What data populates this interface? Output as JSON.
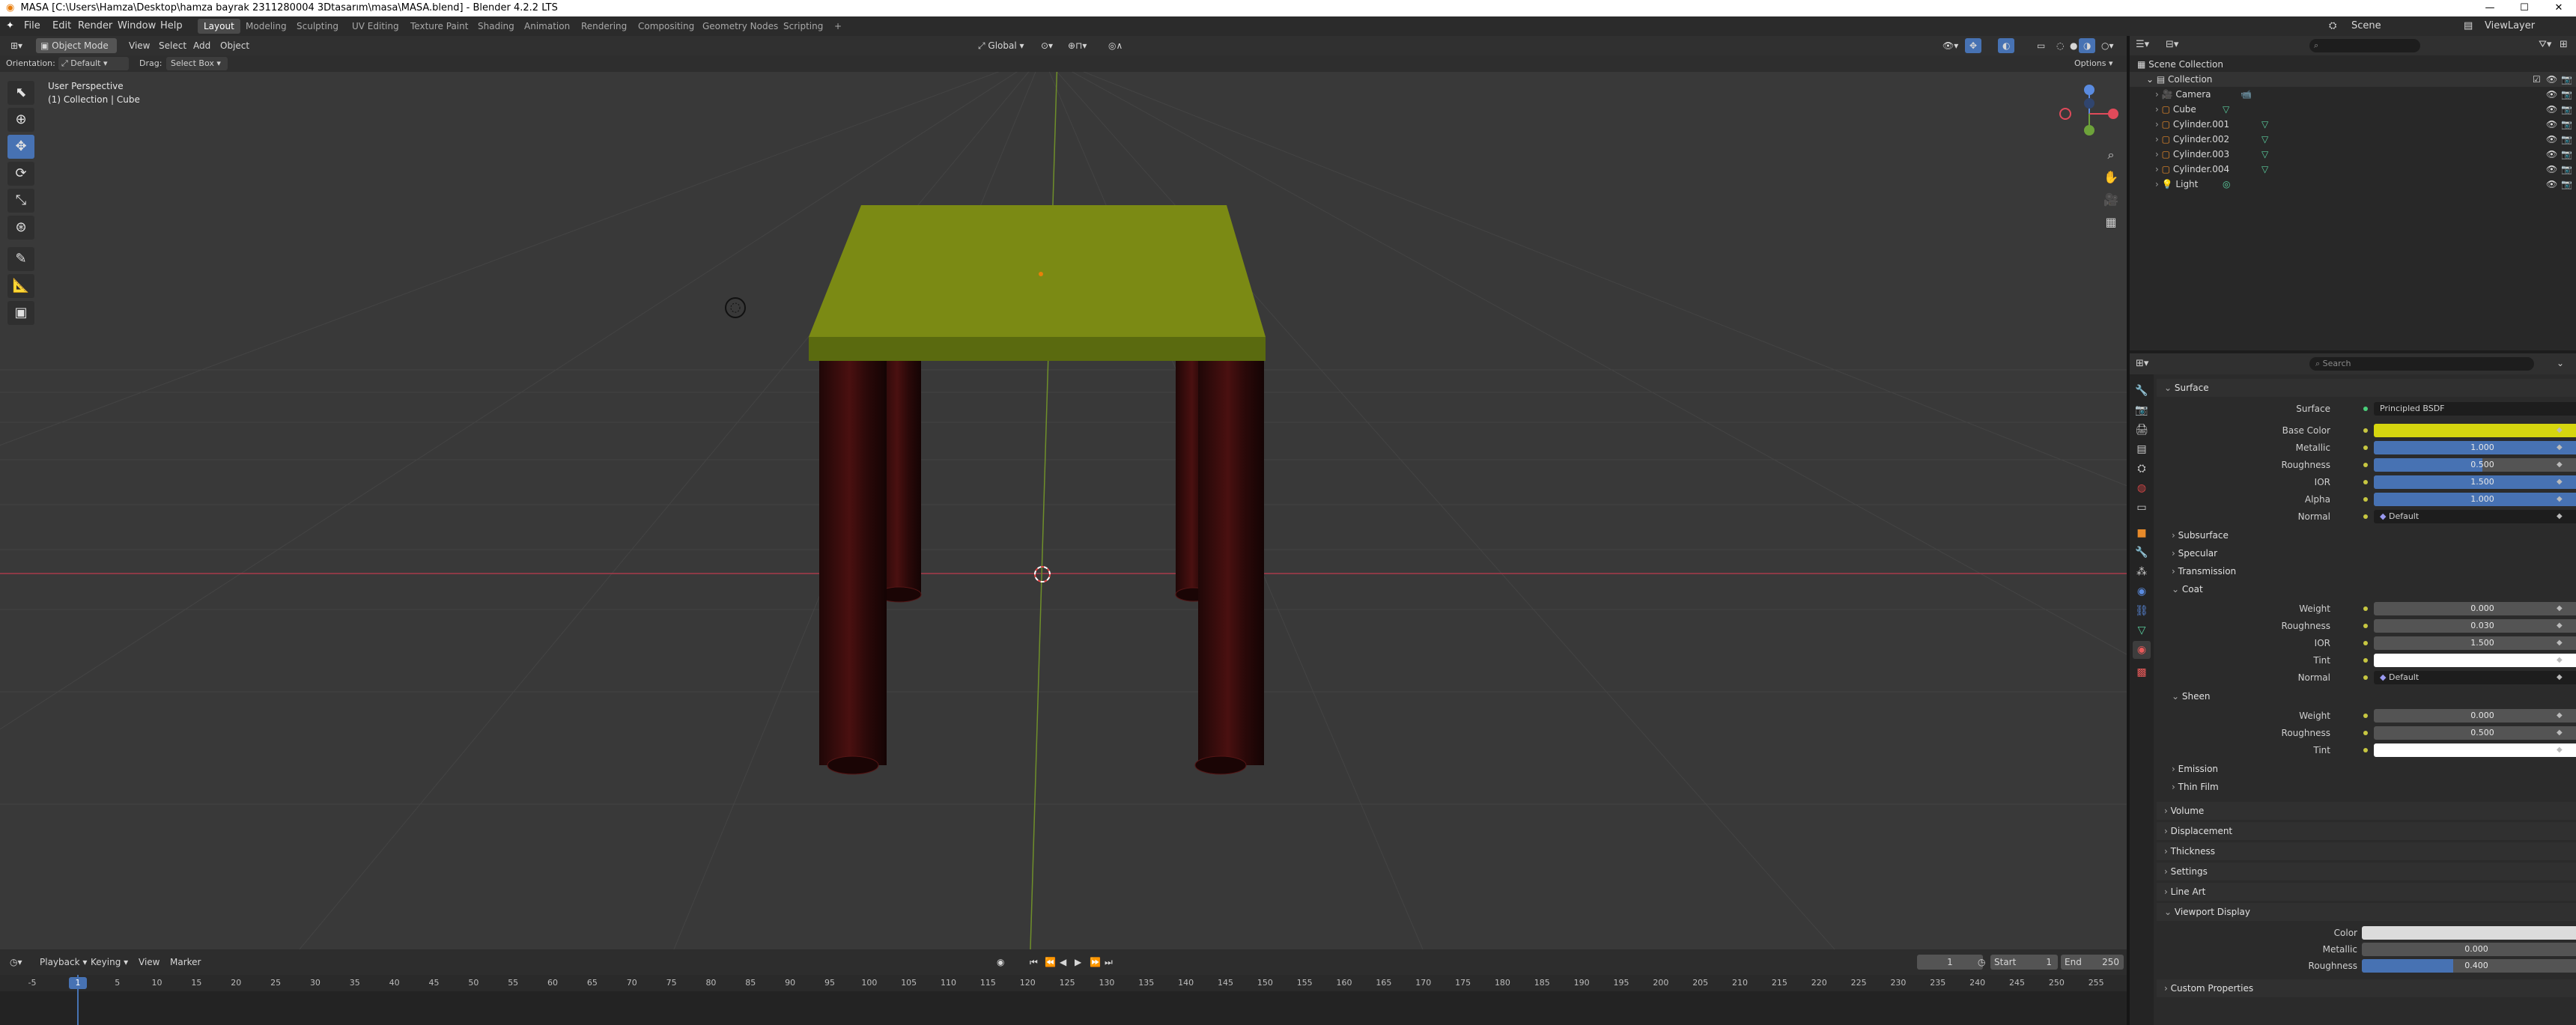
{
  "window": {
    "title": "MASA [C:\\Users\\Hamza\\Desktop\\hamza bayrak 2311280004   3Dtasarım\\masa\\MASA.blend] - Blender 4.2.2 LTS"
  },
  "menu": [
    "File",
    "Edit",
    "Render",
    "Window",
    "Help"
  ],
  "workspaces": [
    "Layout",
    "Modeling",
    "Sculpting",
    "UV Editing",
    "Texture Paint",
    "Shading",
    "Animation",
    "Rendering",
    "Compositing",
    "Geometry Nodes",
    "Scripting"
  ],
  "active_workspace": "Layout",
  "scene": {
    "name": "Scene",
    "view_layer": "ViewLayer"
  },
  "viewport_header": {
    "mode": "Object Mode",
    "view": "View",
    "select": "Select",
    "add": "Add",
    "object": "Object",
    "orientation_transform": "Global",
    "options": "Options"
  },
  "tool_header": {
    "orientation_label": "Orientation:",
    "orientation": "Default",
    "drag_label": "Drag:",
    "drag": "Select Box"
  },
  "viewport_overlay": {
    "perspective": "User Perspective",
    "context": "(1) Collection | Cube"
  },
  "timeline": {
    "playback": "Playback",
    "keying": "Keying",
    "view": "View",
    "marker": "Marker",
    "current_frame": "1",
    "start_label": "Start",
    "start": "1",
    "end_label": "End",
    "end": "250",
    "ticks": [
      "-5",
      "0",
      "5",
      "10",
      "15",
      "20",
      "25",
      "30",
      "35",
      "40",
      "45",
      "50",
      "55",
      "60",
      "65",
      "70",
      "75",
      "80",
      "85",
      "90",
      "95",
      "100",
      "105",
      "110",
      "115",
      "120",
      "125",
      "130",
      "135",
      "140",
      "145",
      "150",
      "155",
      "160",
      "165",
      "170",
      "175",
      "180",
      "185",
      "190",
      "195",
      "200",
      "205",
      "210",
      "215",
      "220",
      "225",
      "230",
      "235",
      "240",
      "245",
      "250",
      "255"
    ]
  },
  "outliner": {
    "search_placeholder": "",
    "root": "Scene Collection",
    "collection": "Collection",
    "items": [
      "Camera",
      "Cube",
      "Cylinder.001",
      "Cylinder.002",
      "Cylinder.003",
      "Cylinder.004",
      "Light"
    ]
  },
  "properties": {
    "search_placeholder": "Search",
    "surface_section": "Surface",
    "surface_label": "Surface",
    "surface_value": "Principled BSDF",
    "rows": [
      {
        "label": "Base Color",
        "type": "color",
        "color": "#d6d60f"
      },
      {
        "label": "Metallic",
        "value": "1.000",
        "fill": 1.0
      },
      {
        "label": "Roughness",
        "value": "0.500",
        "fill": 0.5
      },
      {
        "label": "IOR",
        "value": "1.500",
        "fill": 1.0
      },
      {
        "label": "Alpha",
        "value": "1.000",
        "fill": 1.0
      },
      {
        "label": "Normal",
        "value": "Default",
        "type": "text"
      }
    ],
    "collapsed": [
      "Subsurface",
      "Specular",
      "Transmission"
    ],
    "coat_section": "Coat",
    "coat_rows": [
      {
        "label": "Weight",
        "value": "0.000"
      },
      {
        "label": "Roughness",
        "value": "0.030"
      },
      {
        "label": "IOR",
        "value": "1.500"
      },
      {
        "label": "Tint",
        "type": "color",
        "color": "#ffffff"
      },
      {
        "label": "Normal",
        "value": "Default",
        "type": "text"
      }
    ],
    "sheen_section": "Sheen",
    "sheen_rows": [
      {
        "label": "Weight",
        "value": "0.000"
      },
      {
        "label": "Roughness",
        "value": "0.500"
      },
      {
        "label": "Tint",
        "type": "color",
        "color": "#ffffff"
      }
    ],
    "more_sub": [
      "Emission",
      "Thin Film"
    ],
    "panels": [
      "Volume",
      "Displacement",
      "Thickness",
      "Settings",
      "Line Art"
    ],
    "viewport_display": "Viewport Display",
    "vd_rows": [
      {
        "label": "Color",
        "type": "color",
        "color": "#dcdcdc"
      },
      {
        "label": "Metallic",
        "value": "0.000",
        "fill": 0
      },
      {
        "label": "Roughness",
        "value": "0.400",
        "fill": 0.4
      }
    ],
    "custom_props": "Custom Properties"
  }
}
